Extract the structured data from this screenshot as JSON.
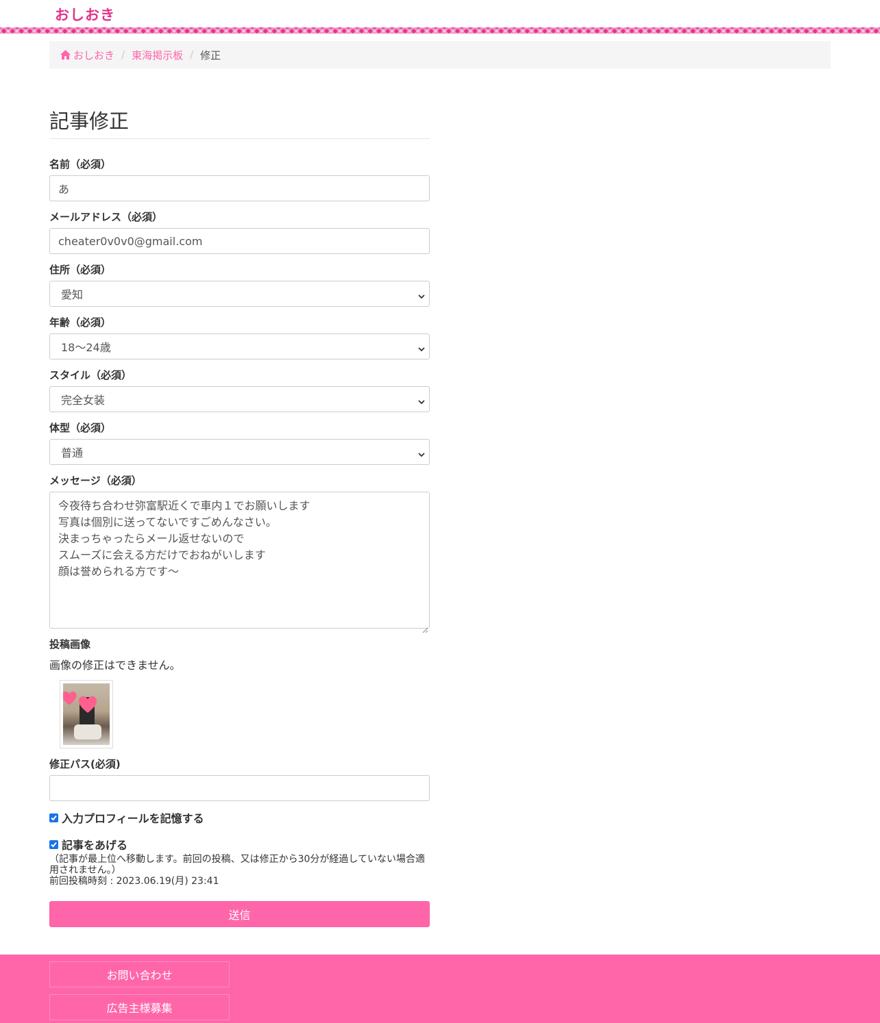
{
  "header": {
    "logo": "おしおき"
  },
  "breadcrumb": {
    "home": "おしおき",
    "board": "東海掲示板",
    "current": "修正"
  },
  "page": {
    "title": "記事修正"
  },
  "form": {
    "name_label": "名前（必須）",
    "name_value": "あ",
    "email_label": "メールアドレス（必須）",
    "email_value": "cheater0v0v0@gmail.com",
    "address_label": "住所（必須）",
    "address_value": "愛知",
    "age_label": "年齢（必須）",
    "age_value": "18〜24歳",
    "style_label": "スタイル（必須）",
    "style_value": "完全女装",
    "body_label": "体型（必須）",
    "body_value": "普通",
    "message_label": "メッセージ（必須）",
    "message_lines": [
      "今夜待ち合わせ弥富駅近くで車内１でお願いします",
      "写真は個別に送ってないですごめんなさい。",
      "決まっちゃったらメール返せないので",
      "スムーズに会える方だけでおねがいします",
      "顔は誉められる方です〜"
    ],
    "image_label": "投稿画像",
    "image_note": "画像の修正はできません。",
    "password_label": "修正パス(必須)",
    "password_value": "",
    "remember_label": "入力プロフィールを記憶する",
    "remember_checked": true,
    "bump_label": "記事をあげる",
    "bump_checked": true,
    "bump_note": "（記事が最上位へ移動します。前回の投稿、又は修正から30分が経過していない場合適用されません。）",
    "last_post": "前回投稿時刻 : 2023.06.19(月) 23:41",
    "submit_label": "送信"
  },
  "footer": {
    "contact": "お問い合わせ",
    "advertise": "広告主様募集"
  },
  "colors": {
    "brand": "#e2338d",
    "accent": "#ff66aa",
    "link": "#ff66aa",
    "breadcrumb_bg": "#f5f5f5"
  },
  "icons": {
    "home": "home-icon",
    "select": "chevron-down-icon",
    "check": "check-icon"
  }
}
